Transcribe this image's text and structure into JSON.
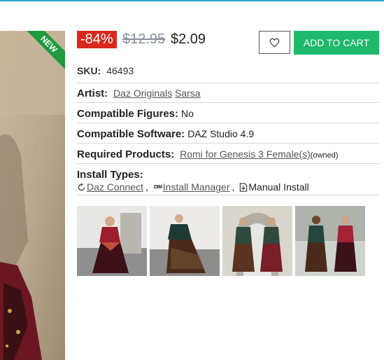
{
  "badge": {
    "new": "NEW"
  },
  "price": {
    "discount": "-84%",
    "original": "$12.95",
    "current": "$2.09"
  },
  "actions": {
    "wishlist_icon": "heart-icon",
    "add_to_cart": "ADD TO CART"
  },
  "sku": {
    "label": "SKU:",
    "value": "46493"
  },
  "details": {
    "artist_label": "Artist:",
    "artists": [
      "Daz Originals",
      "Sarsa"
    ],
    "figures_label": "Compatible Figures:",
    "figures_value": "No",
    "software_label": "Compatible Software:",
    "software_value": "DAZ Studio 4.9",
    "required_label": "Required Products:",
    "required_link": "Romi for Genesis 3 Female(s)",
    "required_note": "(owned)",
    "install_label": "Install Types:",
    "install_types": [
      "Daz Connect",
      "Install Manager",
      "Manual Install"
    ],
    "install_dim_mark": "DIM"
  },
  "thumbnails": [
    "front view",
    "twirl view",
    "front and back view",
    "side and back view"
  ],
  "colors": {
    "accent": "#1db86a",
    "sale": "#d9291c",
    "new_badge": "#1f9a3f",
    "top_border": "#2aa0d6"
  }
}
